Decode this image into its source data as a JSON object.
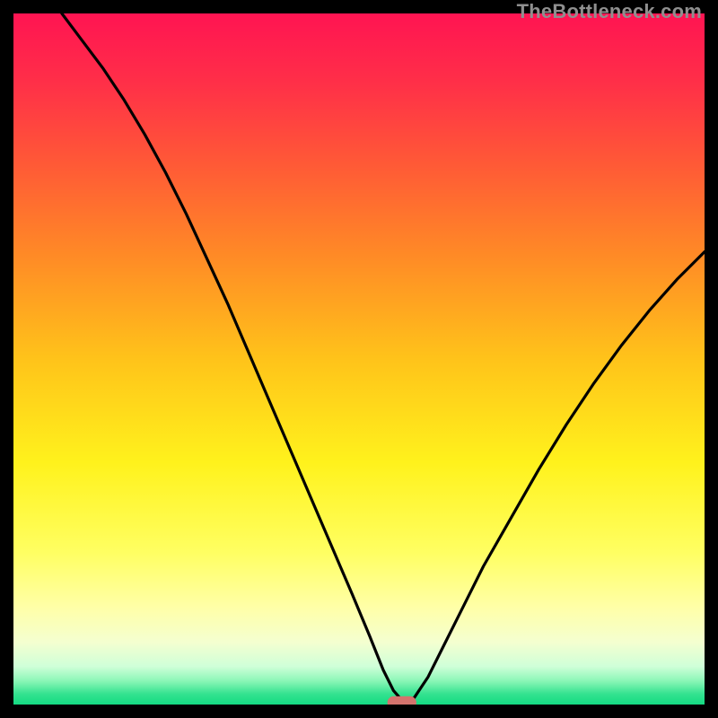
{
  "watermark": "TheBottleneck.com",
  "colors": {
    "bg": "#000000",
    "curve": "#000000",
    "marker_fill": "#d4736d",
    "gradient_stops": [
      {
        "offset": 0.0,
        "color": "#ff1452"
      },
      {
        "offset": 0.1,
        "color": "#ff2f48"
      },
      {
        "offset": 0.22,
        "color": "#ff5a36"
      },
      {
        "offset": 0.35,
        "color": "#ff8a26"
      },
      {
        "offset": 0.5,
        "color": "#ffc31a"
      },
      {
        "offset": 0.65,
        "color": "#fff21c"
      },
      {
        "offset": 0.78,
        "color": "#ffff62"
      },
      {
        "offset": 0.86,
        "color": "#ffffa8"
      },
      {
        "offset": 0.91,
        "color": "#f4ffd0"
      },
      {
        "offset": 0.945,
        "color": "#cfffd8"
      },
      {
        "offset": 0.965,
        "color": "#8ef7b8"
      },
      {
        "offset": 0.985,
        "color": "#33e28f"
      },
      {
        "offset": 1.0,
        "color": "#14db82"
      }
    ]
  },
  "chart_data": {
    "type": "line",
    "title": "",
    "xlabel": "",
    "ylabel": "",
    "xlim": [
      0,
      100
    ],
    "ylim": [
      0,
      100
    ],
    "x": [
      7,
      10,
      13,
      16,
      19,
      22,
      25,
      28,
      31,
      34,
      37,
      40,
      43,
      46,
      49,
      51.5,
      53.5,
      55,
      56.5,
      58,
      60,
      62,
      65,
      68,
      72,
      76,
      80,
      84,
      88,
      92,
      96,
      100
    ],
    "values": [
      100,
      96,
      92,
      87.5,
      82.5,
      77,
      71,
      64.5,
      58,
      51,
      44,
      37,
      30,
      23,
      16,
      10,
      5,
      2,
      0.3,
      1,
      4,
      8,
      14,
      20,
      27,
      34,
      40.5,
      46.5,
      52,
      57,
      61.5,
      65.5
    ],
    "marker": {
      "x": 56.2,
      "y": 0.3,
      "rx": 2.1,
      "ry": 0.9
    }
  }
}
